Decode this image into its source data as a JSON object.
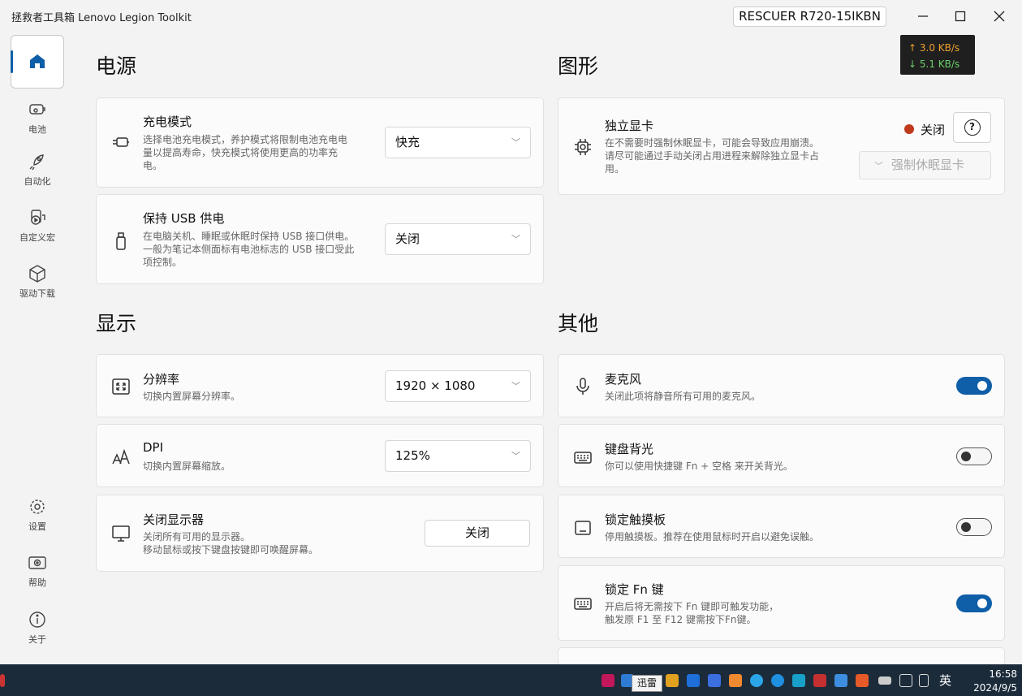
{
  "window": {
    "title": "拯救者工具箱 Lenovo Legion Toolkit",
    "device": "RESCUER R720-15IKBN"
  },
  "netspeed": {
    "up": "↑ 3.0 KB/s",
    "down": "↓ 5.1 KB/s"
  },
  "nav": {
    "battery": "电池",
    "automation": "自动化",
    "macro": "自定义宏",
    "drivers": "驱动下载",
    "settings": "设置",
    "help": "帮助",
    "about": "关于"
  },
  "sections": {
    "power": "电源",
    "graphics": "图形",
    "display": "显示",
    "other": "其他"
  },
  "power": {
    "charge_mode": {
      "title": "充电模式",
      "desc_1": "选择电池充电模式，养护模式将限制电池充电电",
      "desc_2": "量以提高寿命，快充模式将使用更高的功率充",
      "desc_3": "电。",
      "value": "快充"
    },
    "usb_power": {
      "title": "保持 USB 供电",
      "desc_1": "在电脑关机、睡眠或休眠时保持 USB 接口供电。",
      "desc_2": "一般为笔记本侧面标有电池标志的 USB 接口受此",
      "desc_3": "项控制。",
      "value": "关闭"
    }
  },
  "graphics": {
    "dgpu": {
      "title": "独立显卡",
      "desc_1": "在不需要时强制休眠显卡，可能会导致应用崩溃。",
      "desc_2": "请尽可能通过手动关闭占用进程来解除独立显卡占",
      "desc_3": "用。",
      "status": "关闭",
      "status_color": "#c0391b",
      "help_glyph": "?",
      "force_sleep": "强制休眠显卡"
    }
  },
  "display": {
    "resolution": {
      "title": "分辨率",
      "desc": "切换内置屏幕分辨率。",
      "value": "1920 × 1080"
    },
    "dpi": {
      "title": "DPI",
      "desc": "切换内置屏幕缩放。",
      "value": "125%"
    },
    "turn_off": {
      "title": "关闭显示器",
      "desc_1": "关闭所有可用的显示器。",
      "desc_2": "移动鼠标或按下键盘按键即可唤醒屏幕。",
      "button": "关闭"
    }
  },
  "other": {
    "microphone": {
      "title": "麦克风",
      "desc": "关闭此项将静音所有可用的麦克风。",
      "enabled": true
    },
    "kb_backlight": {
      "title": "键盘背光",
      "desc": "你可以使用快捷键 Fn + 空格 来开关背光。",
      "enabled": false
    },
    "touchpad_lock": {
      "title": "锁定触摸板",
      "desc": "停用触摸板。推荐在使用鼠标时开启以避免误触。",
      "enabled": false
    },
    "fn_lock": {
      "title": "锁定 Fn 键",
      "desc_1": "开启后将无需按下 Fn 键即可触发功能，",
      "desc_2": "触发原 F1 至 F12 键需按下Fn键。",
      "enabled": true
    }
  },
  "taskbar": {
    "tooltip": "迅雷",
    "ime": "英",
    "time": "16:58",
    "date": "2024/9/5"
  },
  "colors": {
    "accent": "#0f5ea8"
  }
}
